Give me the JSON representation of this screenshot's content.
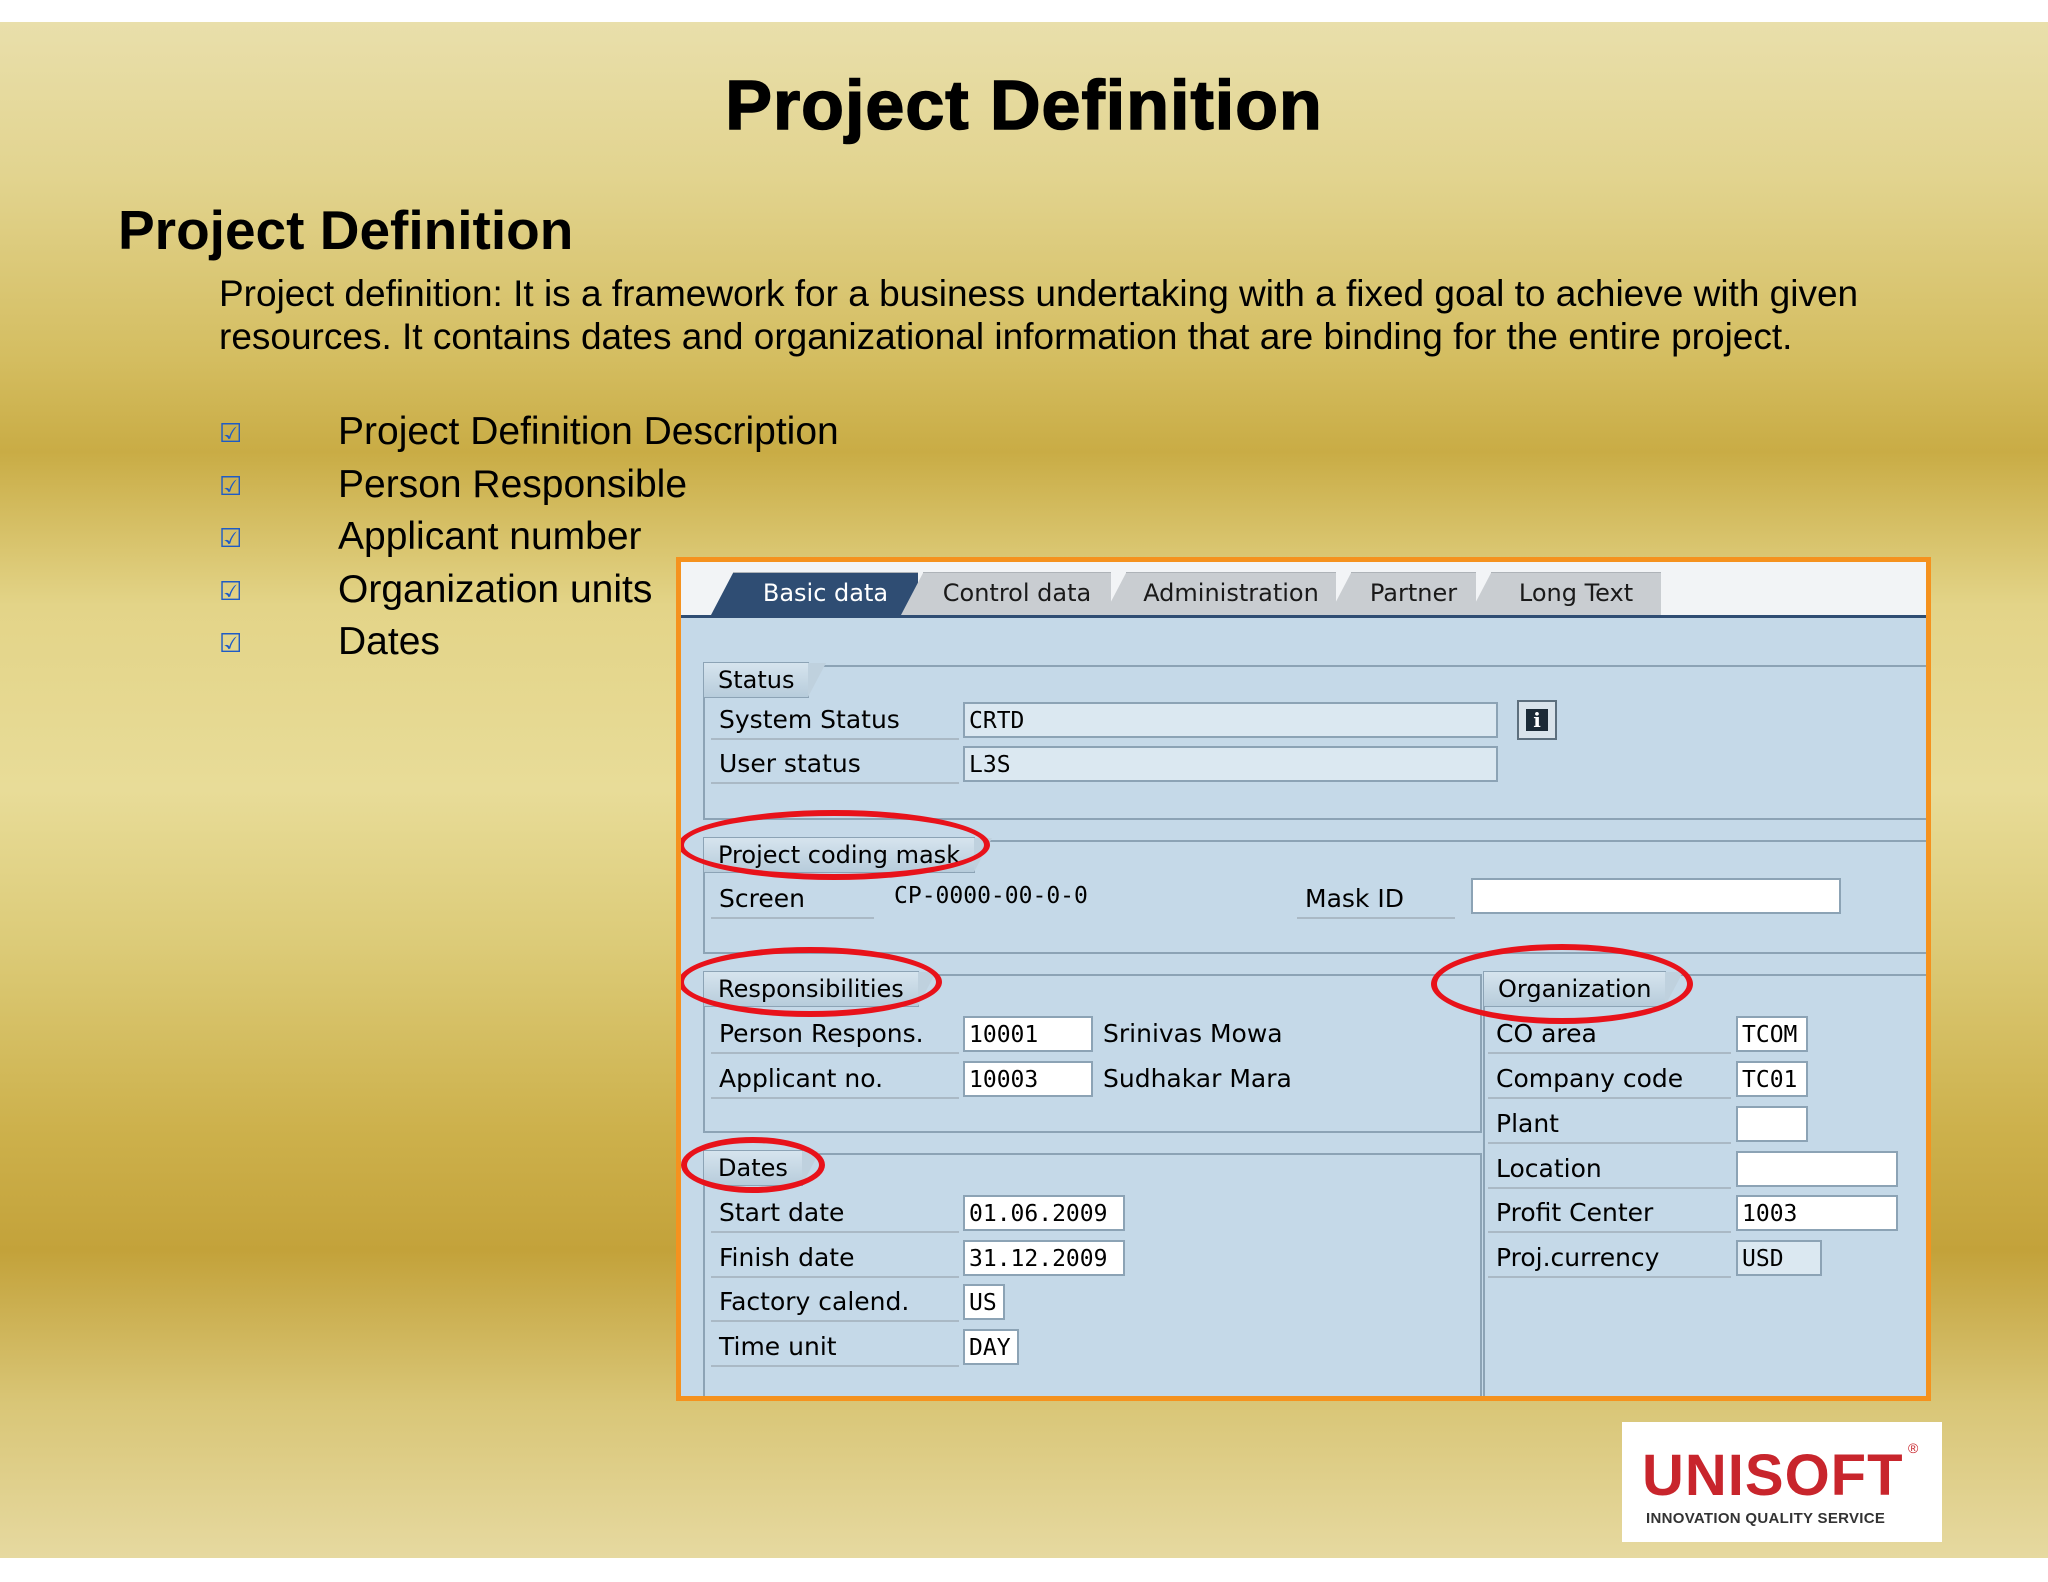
{
  "slide": {
    "title": "Project Definition",
    "subtitle": "Project Definition",
    "paragraph": "Project definition: It is a framework for a business undertaking with a fixed goal to achieve with given resources. It contains dates and organizational information that are binding for the entire project.",
    "bullets": [
      "Project Definition Description",
      "Person Responsible",
      "Applicant number",
      "Organization units",
      "Dates"
    ],
    "check_glyph": "☑"
  },
  "sap": {
    "tabs": [
      "Basic data",
      "Control data",
      "Administration",
      "Partner",
      "Long Text"
    ],
    "status": {
      "header": "Status",
      "system_status_label": "System Status",
      "system_status_value": "CRTD",
      "user_status_label": "User status",
      "user_status_value": "L3S",
      "info_icon": "i"
    },
    "coding_mask": {
      "header": "Project coding mask",
      "screen_label": "Screen",
      "screen_value": "CP-0000-00-0-0",
      "mask_id_label": "Mask ID",
      "mask_id_value": ""
    },
    "responsibilities": {
      "header": "Responsibilities",
      "person_label": "Person Respons.",
      "person_value": "10001",
      "person_name": "Srinivas Mowa",
      "applicant_label": "Applicant no.",
      "applicant_value": "10003",
      "applicant_name": "Sudhakar Mara"
    },
    "dates": {
      "header": "Dates",
      "start_label": "Start date",
      "start_value": "01.06.2009",
      "finish_label": "Finish date",
      "finish_value": "31.12.2009",
      "calendar_label": "Factory calend.",
      "calendar_value": "US",
      "time_unit_label": "Time unit",
      "time_unit_value": "DAY"
    },
    "organization": {
      "header": "Organization",
      "co_area_label": "CO area",
      "co_area_value": "TCOM",
      "company_code_label": "Company code",
      "company_code_value": "TC01",
      "plant_label": "Plant",
      "plant_value": "",
      "location_label": "Location",
      "location_value": "",
      "profit_center_label": "Profit Center",
      "profit_center_value": "1003",
      "currency_label": "Proj.currency",
      "currency_value": "USD"
    },
    "highlight_color": "#e8121a",
    "frame_color": "#f5921e"
  },
  "logo": {
    "brand": "UNISOFT",
    "registered": "®",
    "tagline": "INNOVATION QUALITY SERVICE"
  }
}
